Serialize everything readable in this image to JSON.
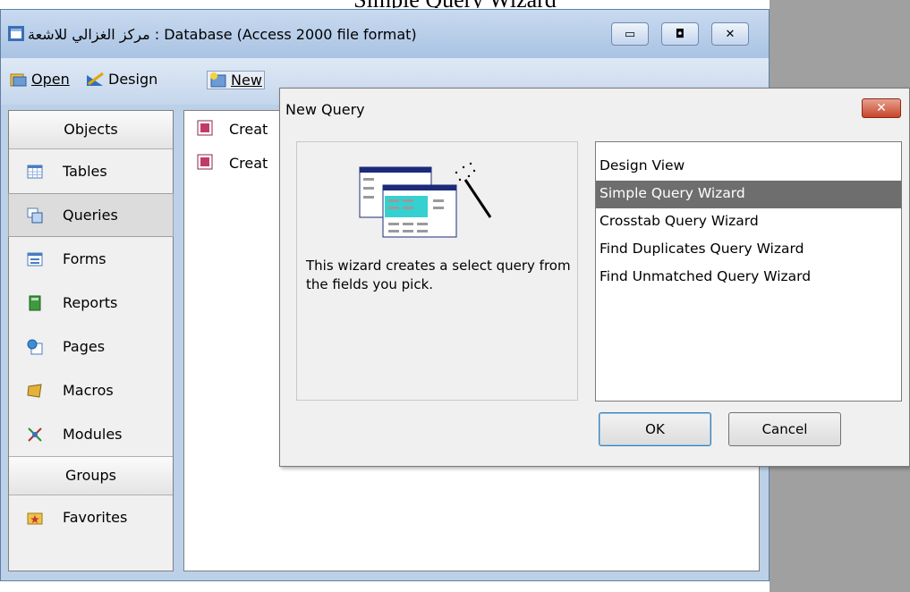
{
  "top_caption": "Simple Query Wizard",
  "db_window": {
    "title": "مركز الغزالي للاشعة : Database (Access 2000 file format)",
    "controls": [
      "minimize-icon",
      "maximize-icon",
      "close-icon"
    ],
    "toolbar": {
      "open_label": "Open",
      "design_label": "Design",
      "new_label": "New"
    },
    "objects_header": "Objects",
    "objects": [
      {
        "label": "Tables",
        "icon": "table-icon"
      },
      {
        "label": "Queries",
        "icon": "query-icon"
      },
      {
        "label": "Forms",
        "icon": "form-icon"
      },
      {
        "label": "Reports",
        "icon": "report-icon"
      },
      {
        "label": "Pages",
        "icon": "page-icon"
      },
      {
        "label": "Macros",
        "icon": "macro-icon"
      },
      {
        "label": "Modules",
        "icon": "module-icon"
      }
    ],
    "selected_object": "Queries",
    "groups_header": "Groups",
    "groups": [
      {
        "label": "Favorites",
        "icon": "favorites-folder-icon"
      }
    ],
    "list_items": [
      "Creat",
      "Creat"
    ]
  },
  "dialog": {
    "title": "New Query",
    "description": "This wizard creates a select query from the fields you pick.",
    "options": [
      "Design View",
      "Simple Query Wizard",
      "Crosstab Query Wizard",
      "Find Duplicates Query Wizard",
      "Find Unmatched Query Wizard"
    ],
    "selected_option": "Simple Query Wizard",
    "ok_label": "OK",
    "cancel_label": "Cancel"
  },
  "colors": {
    "title_bar": "#bcd0e8",
    "selection": "#6e6e6e",
    "close_button": "#c7462a"
  }
}
